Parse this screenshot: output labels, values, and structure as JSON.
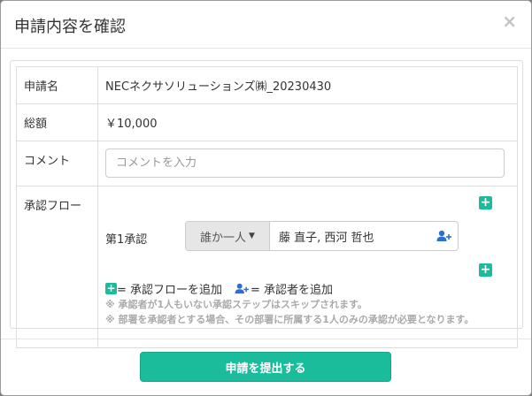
{
  "modal": {
    "title": "申請内容を確認",
    "close_label": "×"
  },
  "form": {
    "name_label": "申請名",
    "name_value": "NECネクサソリューションズ㈱_20230430",
    "amount_label": "総額",
    "amount_value": "￥10,000",
    "comment_label": "コメント",
    "comment_placeholder": "コメントを入力",
    "comment_value": "",
    "flow_label": "承認フロー"
  },
  "flow": {
    "add_icon": "plus-icon",
    "step": {
      "label": "第1承認",
      "select_value": "誰か一人",
      "approvers": "藤 直子, 西河 哲也",
      "user_add_icon": "user-plus-icon"
    },
    "legend": {
      "add_flow": "= 承認フローを追加",
      "add_approver": "= 承認者を追加"
    },
    "notes": [
      "※ 承認者が1人もいない承認ステップはスキップされます。",
      "※ 部署を承認者とする場合、その部署に所属する1人のみの承認が必要となります。"
    ]
  },
  "footer": {
    "submit_label": "申請を提出する"
  },
  "colors": {
    "accent": "#1abc9c",
    "user_icon": "#2c6fd1"
  }
}
